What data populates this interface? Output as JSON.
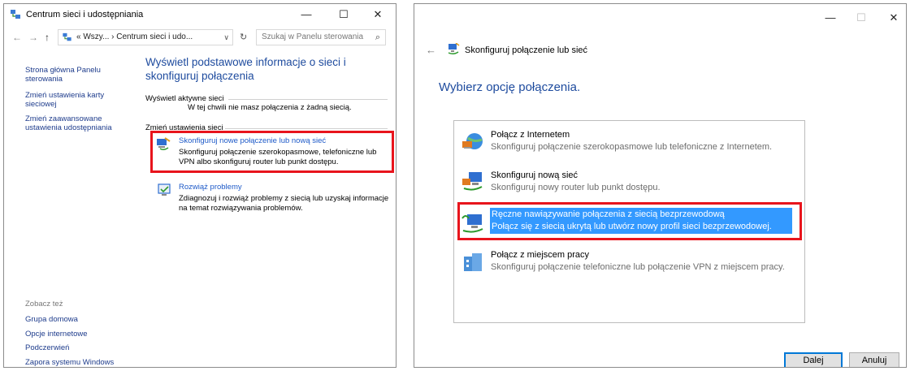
{
  "left_window": {
    "title": "Centrum sieci i udostępniania",
    "buttons": {
      "minimize": "—",
      "maximize": "☐",
      "close": "✕"
    },
    "nav": {
      "back": "←",
      "forward": "→",
      "up": "↑"
    },
    "address": "« Wszy... › Centrum sieci i udo...",
    "address_dropdown": "∨",
    "refresh": "↻",
    "search_placeholder": "Szukaj w Panelu sterowania",
    "search_icon": "⌕",
    "sidebar": {
      "items": [
        "Strona główna Panelu sterowania",
        "Zmień ustawienia karty sieciowej",
        "Zmień zaawansowane ustawienia udostępniania"
      ],
      "see_also_label": "Zobacz też",
      "see_also": [
        "Grupa domowa",
        "Opcje internetowe",
        "Podczerwień",
        "Zapora systemu Windows"
      ]
    },
    "main": {
      "title": "Wyświetl podstawowe informacje o sieci i skonfiguruj połączenia",
      "active_label": "Wyświetl aktywne sieci",
      "active_text": "W tej chwili nie masz połączenia z żadną siecią.",
      "change_label": "Zmień ustawienia sieci",
      "tasks": [
        {
          "link": "Skonfiguruj nowe połączenie lub nową sieć",
          "desc": "Skonfiguruj połączenie szerokopasmowe, telefoniczne lub VPN albo skonfiguruj router lub punkt dostępu."
        },
        {
          "link": "Rozwiąż problemy",
          "desc": "Zdiagnozuj i rozwiąż problemy z siecią lub uzyskaj informacje na temat rozwiązywania problemów."
        }
      ]
    }
  },
  "right_window": {
    "buttons": {
      "minimize": "—",
      "maximize": "☐",
      "close": "✕"
    },
    "back": "←",
    "title": "Skonfiguruj połączenie lub sieć",
    "heading": "Wybierz opcję połączenia.",
    "options": [
      {
        "title": "Połącz z Internetem",
        "desc": "Skonfiguruj połączenie szerokopasmowe lub telefoniczne z Internetem.",
        "icon": "globe-connect-icon"
      },
      {
        "title": "Skonfiguruj nową sieć",
        "desc": "Skonfiguruj nowy router lub punkt dostępu.",
        "icon": "new-network-icon"
      },
      {
        "title": "Ręczne nawiązywanie połączenia z siecią bezprzewodową",
        "desc": "Połącz się z siecią ukrytą lub utwórz nowy profil sieci bezprzewodowej.",
        "icon": "wireless-network-icon"
      },
      {
        "title": "Połącz z miejscem pracy",
        "desc": "Skonfiguruj połączenie telefoniczne lub połączenie VPN z miejscem pracy.",
        "icon": "workplace-icon"
      }
    ],
    "next_button": "Dalej",
    "cancel_button": "Anuluj"
  },
  "colors": {
    "highlight": "#e8141c",
    "selection": "#3399ff",
    "link": "#1e5ac8"
  }
}
